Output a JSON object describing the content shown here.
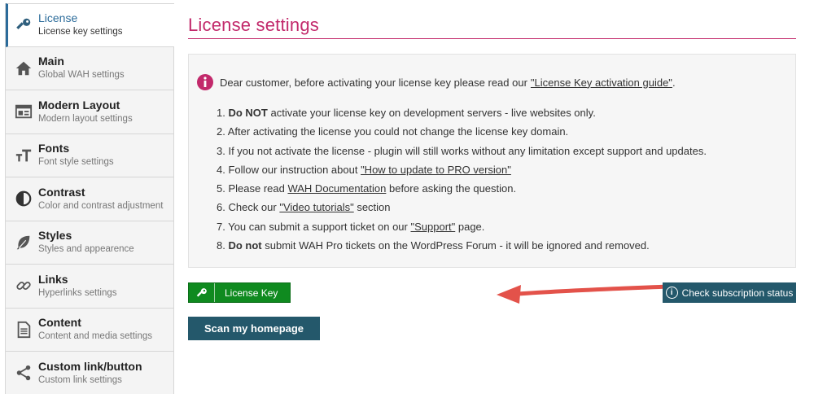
{
  "sidebar": {
    "items": [
      {
        "title": "License",
        "subtitle": "License key settings",
        "icon": "key-icon"
      },
      {
        "title": "Main",
        "subtitle": "Global WAH settings",
        "icon": "home-icon"
      },
      {
        "title": "Modern Layout",
        "subtitle": "Modern layout settings",
        "icon": "layout-icon"
      },
      {
        "title": "Fonts",
        "subtitle": "Font style settings",
        "icon": "fonts-icon"
      },
      {
        "title": "Contrast",
        "subtitle": "Color and contrast adjustment",
        "icon": "contrast-icon"
      },
      {
        "title": "Styles",
        "subtitle": "Styles and appearence",
        "icon": "leaf-icon"
      },
      {
        "title": "Links",
        "subtitle": "Hyperlinks settings",
        "icon": "link-icon"
      },
      {
        "title": "Content",
        "subtitle": "Content and media settings",
        "icon": "document-icon"
      },
      {
        "title": "Custom link/button",
        "subtitle": "Custom link settings",
        "icon": "share-icon"
      }
    ]
  },
  "main": {
    "title": "License settings",
    "notice": {
      "intro": "Dear customer, before activating your license key please read our ",
      "intro_link": "\"License Key activation guide\"",
      "intro_end": ".",
      "items": [
        {
          "num": "1. ",
          "bold": "Do NOT",
          "text": " activate your license key on development servers - live websites only."
        },
        {
          "num": "2. ",
          "text": "After activating the license you could not change the license key domain."
        },
        {
          "num": "3. ",
          "text": "If you not activate the license - plugin will still works without any limitation except support and updates."
        },
        {
          "num": "4. ",
          "text": "Follow our instruction about ",
          "link": "\"How to update to PRO version\""
        },
        {
          "num": "5. ",
          "text": "Please read ",
          "link": "WAH Documentation",
          "after": " before asking the question."
        },
        {
          "num": "6. ",
          "text": "Check our ",
          "link": "\"Video tutorials\"",
          "after": " section"
        },
        {
          "num": "7. ",
          "text": "You can submit a support ticket on our ",
          "link": "\"Support\"",
          "after": " page."
        },
        {
          "num": "8. ",
          "bold": "Do not",
          "text": " submit WAH Pro tickets on the WordPress Forum - it will be ignored and removed."
        }
      ]
    },
    "buttons": {
      "license_key": "License Key",
      "check_subscription": "Check subscription status",
      "scan_homepage": "Scan my homepage"
    }
  },
  "colors": {
    "accent": "#c2296b",
    "primary_button": "#24586b",
    "license_button": "#0f8a1f",
    "arrow": "#e3524a",
    "sidebar_active": "#2b6b9a"
  }
}
